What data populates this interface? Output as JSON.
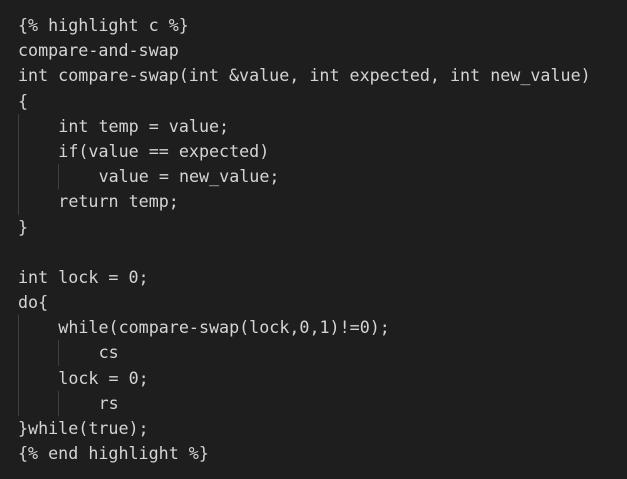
{
  "editor": {
    "background": "#1e1e1e",
    "text_color": "#d4d4d4",
    "lines": [
      {
        "indent": 0,
        "text": "{% highlight c %}"
      },
      {
        "indent": 0,
        "text": "compare-and-swap"
      },
      {
        "indent": 0,
        "text": "int compare-swap(int &value, int expected, int new_value)"
      },
      {
        "indent": 0,
        "text": "{"
      },
      {
        "indent": 1,
        "text": "int temp = value;"
      },
      {
        "indent": 1,
        "text": "if(value == expected)"
      },
      {
        "indent": 2,
        "text": "value = new_value;"
      },
      {
        "indent": 1,
        "text": "return temp;"
      },
      {
        "indent": 0,
        "text": "}"
      },
      {
        "indent": 0,
        "text": ""
      },
      {
        "indent": 0,
        "text": "int lock = 0;"
      },
      {
        "indent": 0,
        "text": "do{"
      },
      {
        "indent": 1,
        "text": "while(compare-swap(lock,0,1)!=0);"
      },
      {
        "indent": 2,
        "text": "cs"
      },
      {
        "indent": 1,
        "text": "lock = 0;"
      },
      {
        "indent": 2,
        "text": "rs"
      },
      {
        "indent": 0,
        "text": "}while(true);"
      },
      {
        "indent": 0,
        "text": "{% end highlight %}"
      }
    ]
  }
}
